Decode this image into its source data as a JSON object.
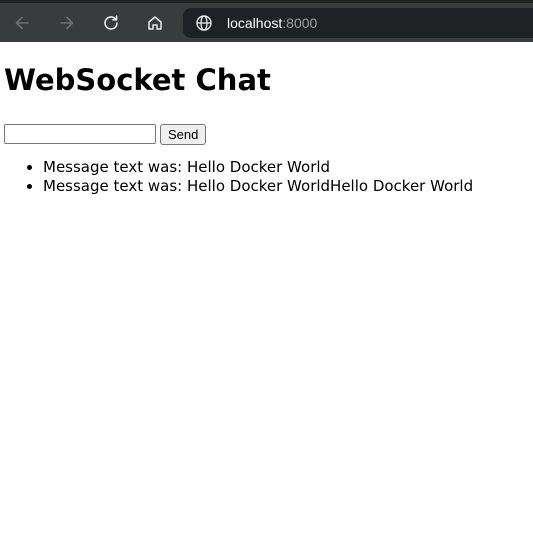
{
  "browser": {
    "url_host": "localhost",
    "url_port": ":8000",
    "icons": [
      "back-arrow-icon",
      "forward-arrow-icon",
      "reload-icon",
      "home-icon",
      "globe-icon"
    ]
  },
  "page": {
    "title": "WebSocket Chat",
    "input_value": "",
    "send_label": "Send",
    "messages": [
      "Message text was: Hello Docker World",
      "Message text was: Hello Docker WorldHello Docker World"
    ]
  }
}
